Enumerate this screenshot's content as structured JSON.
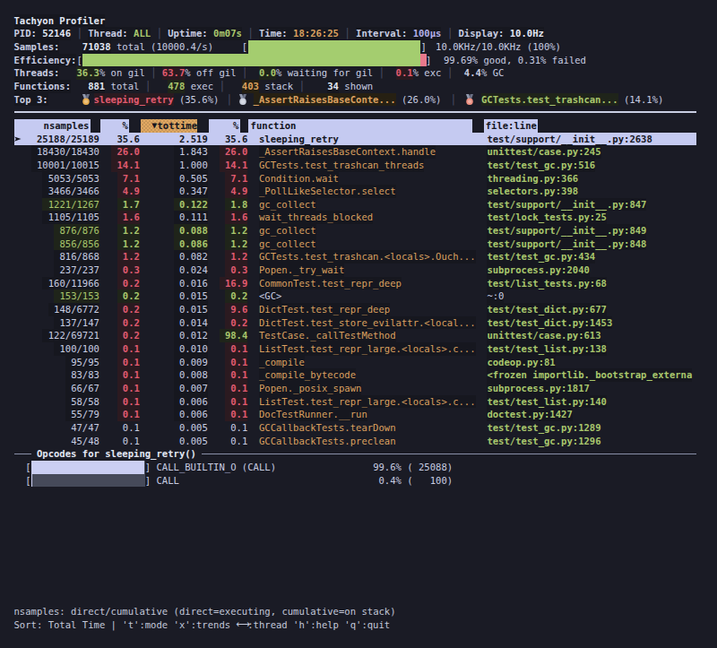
{
  "app": {
    "title": "Tachyon Profiler"
  },
  "colors": {
    "background": "#1a1b25",
    "text": "#c8cde2",
    "green": "#a9c76d",
    "red": "#e15b70",
    "orange": "#daa05f",
    "selection": "#c5caf1",
    "sort_column": "#e2a963",
    "bar_green": "#a4cd6f",
    "bar_fail_pink": "#e37b90",
    "bar_lavender": "#c5caf1"
  },
  "status": {
    "pid": {
      "label": "PID:",
      "value": "52146"
    },
    "thread": {
      "label": "Thread:",
      "value": "ALL"
    },
    "uptime": {
      "label": "Uptime:",
      "value": "0m07s"
    },
    "time": {
      "label": "Time:",
      "value": "18:26:25"
    },
    "interval": {
      "label": "Interval:",
      "value": "100µs"
    },
    "display": {
      "label": "Display:",
      "value": "10.0Hz"
    },
    "separator": "│"
  },
  "samples": {
    "label": "Samples:",
    "total": "71038",
    "suffix": "total (10000.4/s)",
    "open": "[",
    "close": "]",
    "rate": "10.0KHz/10.0KHz (100%)",
    "bar_fill": 1.0
  },
  "efficiency": {
    "label": "Efficiency:",
    "open": "[",
    "close": "]",
    "summary": "99.69% good, 0.31% failed",
    "good_pct": 99.69,
    "failed_pct": 0.31
  },
  "threads": {
    "label": "Threads:",
    "on_gil": {
      "value": "36.3",
      "suffix": "% on gil"
    },
    "off_gil": {
      "value": "63.7",
      "suffix": "% off gil"
    },
    "waiting": {
      "value": "0.0",
      "suffix": "% waiting for gil"
    },
    "exc": {
      "value": "0.1",
      "suffix": "% exc"
    },
    "gc": {
      "value": "4.4",
      "suffix": "% GC"
    }
  },
  "functions": {
    "label": "Functions:",
    "total": {
      "value": "881",
      "suffix": "total"
    },
    "exec": {
      "value": "478",
      "suffix": "exec"
    },
    "stack": {
      "value": "403",
      "suffix": "stack"
    },
    "shown": {
      "value": "34",
      "suffix": "shown"
    }
  },
  "top3": {
    "label": "Top 3:",
    "separator": "│",
    "items": [
      {
        "rank": "gold-medal",
        "medal_color": "#e6ab4e",
        "ribbon_color": "#9aa0b5",
        "name": "sleeping_retry",
        "pct": "(35.6%)"
      },
      {
        "rank": "silver-medal",
        "medal_color": "#c9cedb",
        "ribbon_color": "#9aa0b5",
        "name": "_AssertRaisesBaseConte...",
        "pct": "(26.0%)"
      },
      {
        "rank": "bronze-medal",
        "medal_color": "#ec8f80",
        "ribbon_color": "#9aa0b5",
        "name": "GCTests.test_trashcan...",
        "pct": "(14.1%)"
      }
    ]
  },
  "table": {
    "headers": {
      "nsamples": "nsamples",
      "pct1": "%",
      "sort_indicator": "▼",
      "sort": "tottime",
      "pct2": "%",
      "function": "function",
      "file": "file:line"
    },
    "rows": [
      {
        "sel": true,
        "ns": "25188/25189",
        "p1": "35.6",
        "tt": "2.519",
        "p2": "35.6",
        "fn": "sleeping_retry",
        "fl": "test/support/__init__.py:2638"
      },
      {
        "ns": "18430/18430",
        "nsc": "w",
        "p1": "26.0",
        "p1c": "r",
        "tt": "1.843",
        "ttc": "w",
        "p2": "26.0",
        "p2c": "r",
        "fn": "_AssertRaisesBaseContext.handle",
        "fl": "unittest/case.py:245"
      },
      {
        "ns": "10001/10015",
        "nsc": "w",
        "p1": "14.1",
        "p1c": "r",
        "tt": "1.000",
        "ttc": "w",
        "p2": "14.1",
        "p2c": "r",
        "fn": "GCTests.test_trashcan_threads",
        "fl": "test/test_gc.py:516"
      },
      {
        "ns": "5053/5053",
        "nsc": "w",
        "p1": "7.1",
        "p1c": "r",
        "tt": "0.505",
        "ttc": "w",
        "p2": "7.1",
        "p2c": "r",
        "fn": "Condition.wait",
        "fl": "threading.py:366"
      },
      {
        "ns": "3466/3466",
        "nsc": "w",
        "p1": "4.9",
        "p1c": "r",
        "tt": "0.347",
        "ttc": "w",
        "p2": "4.9",
        "p2c": "r",
        "fn": "_PollLikeSelector.select",
        "fl": "selectors.py:398"
      },
      {
        "ns": "1221/1267",
        "nsc": "g",
        "p1": "1.7",
        "p1c": "g",
        "tt": "0.122",
        "ttc": "g",
        "p2": "1.8",
        "p2c": "g",
        "fn": "gc_collect",
        "fl": "test/support/__init__.py:847"
      },
      {
        "ns": "1105/1105",
        "nsc": "w",
        "p1": "1.6",
        "p1c": "r",
        "tt": "0.111",
        "ttc": "w",
        "p2": "1.6",
        "p2c": "r",
        "fn": "wait_threads_blocked",
        "fl": "test/lock_tests.py:25"
      },
      {
        "ns": "876/876",
        "nsc": "g",
        "p1": "1.2",
        "p1c": "g",
        "tt": "0.088",
        "ttc": "g",
        "p2": "1.2",
        "p2c": "g",
        "fn": "gc_collect",
        "fl": "test/support/__init__.py:849"
      },
      {
        "ns": "856/856",
        "nsc": "g",
        "p1": "1.2",
        "p1c": "g",
        "tt": "0.086",
        "ttc": "g",
        "p2": "1.2",
        "p2c": "g",
        "fn": "gc_collect",
        "fl": "test/support/__init__.py:848"
      },
      {
        "ns": "816/868",
        "nsc": "w",
        "p1": "1.2",
        "p1c": "r",
        "tt": "0.082",
        "ttc": "w",
        "p2": "1.2",
        "p2c": "r",
        "fn": "GCTests.test_trashcan.<locals>.Ouch...",
        "fl": "test/test_gc.py:434"
      },
      {
        "ns": "237/237",
        "nsc": "w",
        "p1": "0.3",
        "p1c": "r",
        "tt": "0.024",
        "ttc": "w",
        "p2": "0.3",
        "p2c": "r",
        "fn": "Popen._try_wait",
        "fl": "subprocess.py:2040"
      },
      {
        "ns": "160/11966",
        "nsc": "w",
        "p1": "0.2",
        "p1c": "r",
        "tt": "0.016",
        "ttc": "w",
        "p2": "16.9",
        "p2c": "r",
        "fn": "CommonTest.test_repr_deep",
        "fl": "test/list_tests.py:68"
      },
      {
        "ns": "153/153",
        "nsc": "g",
        "p1": "0.2",
        "p1c": "g",
        "tt": "0.015",
        "ttc": "w",
        "p2": "0.2",
        "p2c": "g",
        "fn": "<GC>",
        "fnc": "w",
        "fl": "~:0",
        "flc": "w"
      },
      {
        "ns": "148/6772",
        "nsc": "w",
        "p1": "0.2",
        "p1c": "r",
        "tt": "0.015",
        "ttc": "w",
        "p2": "9.6",
        "p2c": "r",
        "fn": "DictTest.test_repr_deep",
        "fl": "test/test_dict.py:677"
      },
      {
        "ns": "137/147",
        "nsc": "w",
        "p1": "0.2",
        "p1c": "r",
        "tt": "0.014",
        "ttc": "w",
        "p2": "0.2",
        "p2c": "r",
        "fn": "DictTest.test_store_evilattr.<local...",
        "fl": "test/test_dict.py:1453"
      },
      {
        "ns": "122/69721",
        "nsc": "w",
        "p1": "0.2",
        "p1c": "r",
        "tt": "0.012",
        "ttc": "w",
        "p2": "98.4",
        "p2c": "g",
        "fn": "TestCase._callTestMethod",
        "fl": "unittest/case.py:613"
      },
      {
        "ns": "100/100",
        "nsc": "w",
        "p1": "0.1",
        "p1c": "r",
        "tt": "0.010",
        "ttc": "w",
        "p2": "0.1",
        "p2c": "r",
        "fn": "ListTest.test_repr_large.<locals>.c...",
        "fl": "test/test_list.py:138"
      },
      {
        "ns": "95/95",
        "nsc": "w",
        "p1": "0.1",
        "p1c": "r",
        "tt": "0.009",
        "ttc": "w",
        "p2": "0.1",
        "p2c": "r",
        "fn": "_compile",
        "fl": "codeop.py:81"
      },
      {
        "ns": "83/83",
        "nsc": "w",
        "p1": "0.1",
        "p1c": "r",
        "tt": "0.008",
        "ttc": "w",
        "p2": "0.1",
        "p2c": "r",
        "fn": "_compile_bytecode",
        "fl": "<frozen importlib._bootstrap_externa"
      },
      {
        "ns": "66/67",
        "nsc": "w",
        "p1": "0.1",
        "p1c": "r",
        "tt": "0.007",
        "ttc": "w",
        "p2": "0.1",
        "p2c": "r",
        "fn": "Popen._posix_spawn",
        "fl": "subprocess.py:1817"
      },
      {
        "ns": "58/58",
        "nsc": "w",
        "p1": "0.1",
        "p1c": "r",
        "tt": "0.006",
        "ttc": "w",
        "p2": "0.1",
        "p2c": "r",
        "fn": "ListTest.test_repr_large.<locals>.c...",
        "fl": "test/test_list.py:140"
      },
      {
        "ns": "55/79",
        "nsc": "w",
        "p1": "0.1",
        "p1c": "r",
        "tt": "0.006",
        "ttc": "w",
        "p2": "0.1",
        "p2c": "r",
        "fn": "DocTestRunner.__run",
        "fl": "doctest.py:1427"
      },
      {
        "ns": "47/47",
        "nsc": "p",
        "p1": "0.1",
        "p1c": "p",
        "tt": "0.005",
        "ttc": "p",
        "p2": "0.1",
        "p2c": "p",
        "fn": "GCCallbackTests.tearDown",
        "fl": "test/test_gc.py:1289"
      },
      {
        "ns": "45/48",
        "nsc": "p",
        "p1": "0.1",
        "p1c": "p",
        "tt": "0.005",
        "ttc": "p",
        "p2": "0.1",
        "p2c": "p",
        "fn": "GCCallbackTests.preclean",
        "fl": "test/test_gc.py:1296"
      }
    ]
  },
  "opcodes": {
    "section_title": "Opcodes for sleeping_retry()",
    "rows": [
      {
        "open": "[",
        "close": "]",
        "label": "CALL_BUILTIN_O (CALL)",
        "stats": "99.6% ( 25088)",
        "fill": 0.996
      },
      {
        "open": "[",
        "close": "]",
        "label": "CALL",
        "stats": " 0.4% (   100)",
        "fill": 0.004
      }
    ]
  },
  "footer": {
    "line1": "nsamples: direct/cumulative (direct=executing, cumulative=on stack)",
    "line2_prefix": "Sort: Total Time | 't':mode 'x':trends ",
    "line2_arrow": "⟷",
    "line2_suffix": ":thread 'h':help 'q':quit"
  }
}
